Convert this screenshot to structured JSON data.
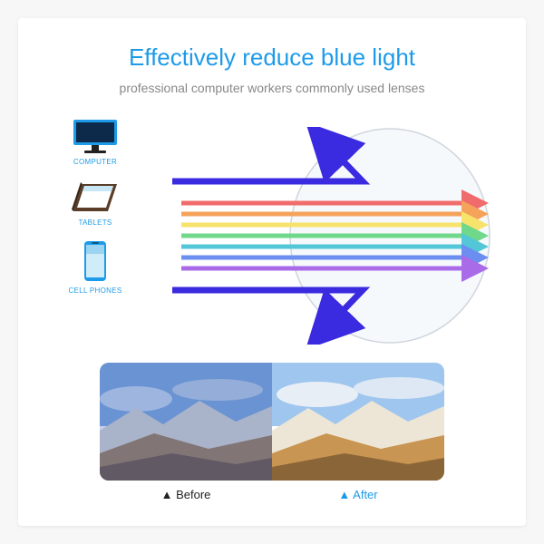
{
  "header": {
    "title": "Effectively reduce blue light",
    "subtitle": "professional computer workers commonly used lenses"
  },
  "devices": [
    {
      "id": "computer",
      "label": "COMPUTER"
    },
    {
      "id": "tablets",
      "label": "TABLETS"
    },
    {
      "id": "cellphones",
      "label": "CELL PHONES"
    }
  ],
  "compare": {
    "before": "Before",
    "after": "After",
    "marker": "▲"
  },
  "ray_colors": {
    "blue": "#3a2ae0",
    "spectrum": [
      "#f06b6b",
      "#f5a35a",
      "#f7e26b",
      "#6fd88a",
      "#53c7d7",
      "#6b8ef0",
      "#a96be8"
    ]
  },
  "lens_stroke": "#cfd6dd"
}
